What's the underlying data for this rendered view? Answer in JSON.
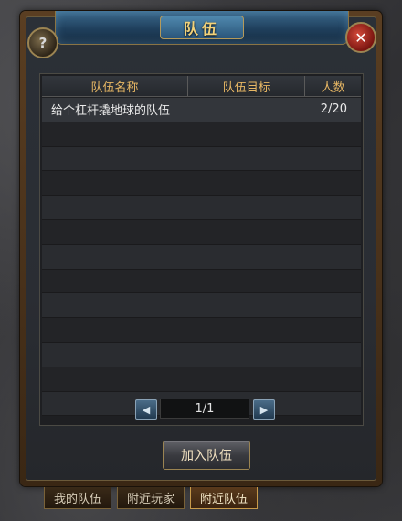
{
  "window": {
    "title": "队伍"
  },
  "table": {
    "headers": [
      "队伍名称",
      "队伍目标",
      "人数"
    ],
    "rows": [
      {
        "name": "给个杠杆撬地球的队伍",
        "goal": "",
        "count": "2/20"
      }
    ],
    "empty_rows": 12
  },
  "pager": {
    "display": "1/1"
  },
  "buttons": {
    "join": "加入队伍"
  },
  "tabs": [
    {
      "label": "我的队伍",
      "active": false
    },
    {
      "label": "附近玩家",
      "active": false
    },
    {
      "label": "附近队伍",
      "active": true
    }
  ],
  "icons": {
    "help": "?",
    "close": "✕",
    "prev": "◀",
    "next": "▶"
  }
}
